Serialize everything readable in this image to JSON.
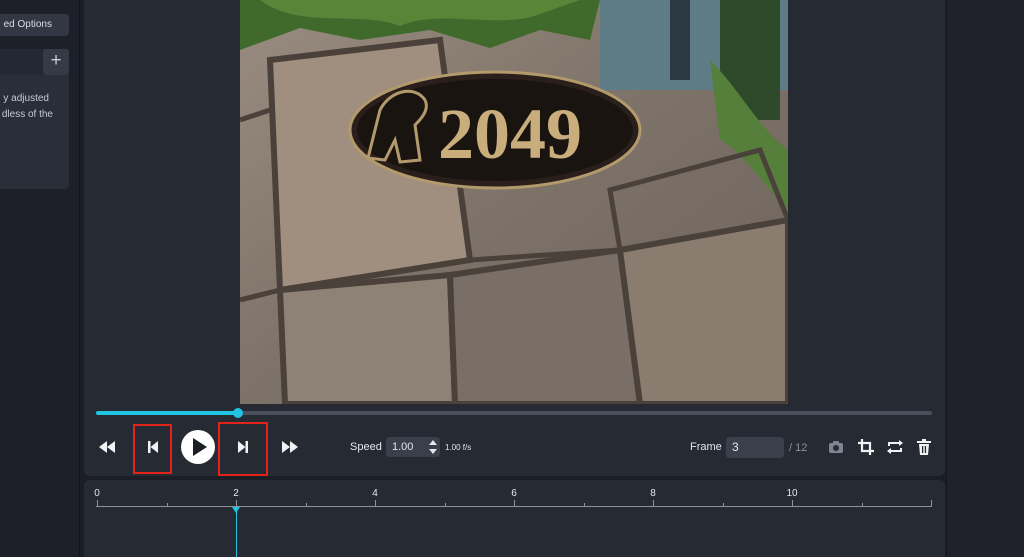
{
  "sidebar": {
    "advanced_label": "ed Options",
    "add_label": "+",
    "note_lines": [
      "y adjusted",
      "dless of the"
    ]
  },
  "image": {
    "sign_text": "2049"
  },
  "playback": {
    "progress_fraction": 0.17,
    "speed_label": "Speed",
    "speed_value": "1.00",
    "speed_fps": "1.00 f/s",
    "frame_label": "Frame",
    "frame_value": "3",
    "frame_total": "/ 12"
  },
  "timeline": {
    "ticks": [
      "0",
      "2",
      "4",
      "6",
      "8",
      "10"
    ],
    "tick_max": 12,
    "playhead_value": 2
  },
  "colors": {
    "accent": "#22c4e3",
    "highlight": "#e2231a"
  },
  "icons": [
    "skip-start-icon",
    "step-back-icon",
    "play-icon",
    "step-forward-icon",
    "skip-end-icon",
    "camera-icon",
    "crop-icon",
    "repeat-icon",
    "trash-icon"
  ]
}
